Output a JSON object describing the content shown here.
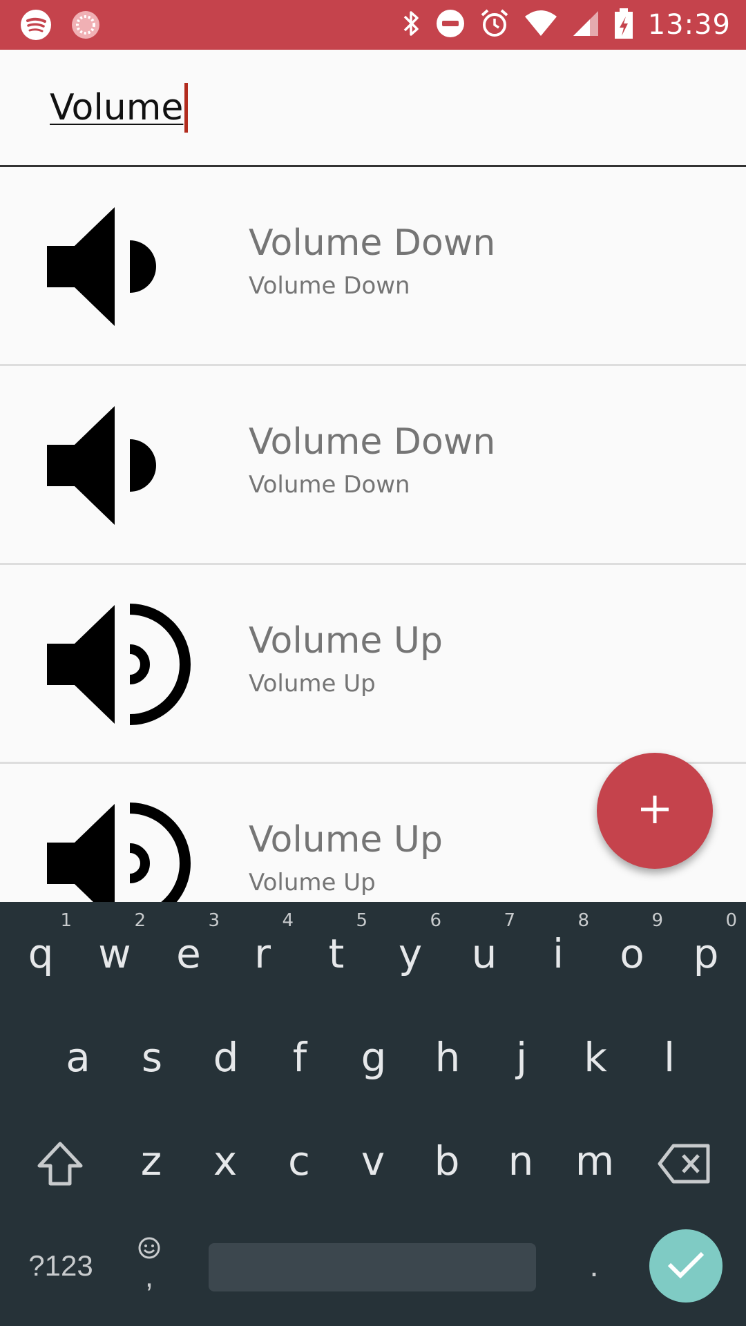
{
  "status_bar": {
    "time": "13:39",
    "color": "#c5434c"
  },
  "search": {
    "value": "Volume"
  },
  "results": [
    {
      "title": "Volume Down",
      "subtitle": "Volume Down",
      "icon": "volume-down-icon"
    },
    {
      "title": "Volume Down",
      "subtitle": "Volume Down",
      "icon": "volume-down-icon"
    },
    {
      "title": "Volume Up",
      "subtitle": "Volume Up",
      "icon": "volume-up-icon"
    },
    {
      "title": "Volume Up",
      "subtitle": "Volume Up",
      "icon": "volume-up-icon"
    }
  ],
  "fab": {
    "label": "+",
    "icon": "add-icon"
  },
  "keyboard": {
    "row1": [
      [
        "q",
        "1"
      ],
      [
        "w",
        "2"
      ],
      [
        "e",
        "3"
      ],
      [
        "r",
        "4"
      ],
      [
        "t",
        "5"
      ],
      [
        "y",
        "6"
      ],
      [
        "u",
        "7"
      ],
      [
        "i",
        "8"
      ],
      [
        "o",
        "9"
      ],
      [
        "p",
        "0"
      ]
    ],
    "row2": [
      "a",
      "s",
      "d",
      "f",
      "g",
      "h",
      "j",
      "k",
      "l"
    ],
    "row3": [
      "z",
      "x",
      "c",
      "v",
      "b",
      "n",
      "m"
    ],
    "symbols_label": "?123",
    "comma": ",",
    "period": "."
  }
}
